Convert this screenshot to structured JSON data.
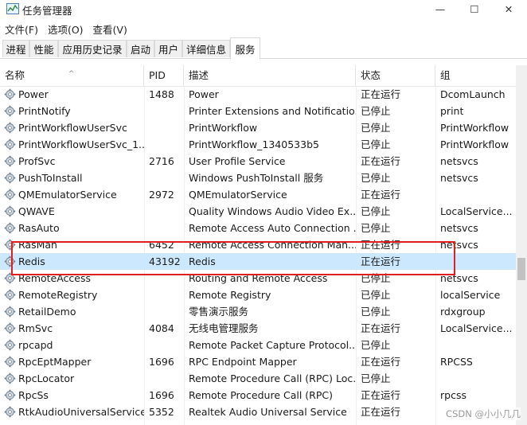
{
  "window": {
    "title": "任务管理器",
    "minimize_glyph": "—",
    "maximize_glyph": "☐",
    "close_glyph": "✕"
  },
  "menu": [
    "文件(F)",
    "选项(O)",
    "查看(V)"
  ],
  "tabs": [
    "进程",
    "性能",
    "应用历史记录",
    "启动",
    "用户",
    "详细信息",
    "服务"
  ],
  "active_tab": "服务",
  "columns": {
    "name": "名称",
    "pid": "PID",
    "desc": "描述",
    "status": "状态",
    "group": "组"
  },
  "sort_indicator": "^",
  "services": [
    {
      "name": "Power",
      "pid": "1488",
      "desc": "Power",
      "status": "正在运行",
      "group": "DcomLaunch"
    },
    {
      "name": "PrintNotify",
      "pid": "",
      "desc": "Printer Extensions and Notificatio...",
      "status": "已停止",
      "group": "print"
    },
    {
      "name": "PrintWorkflowUserSvc",
      "pid": "",
      "desc": "PrintWorkflow",
      "status": "已停止",
      "group": "PrintWorkflow"
    },
    {
      "name": "PrintWorkflowUserSvc_1...",
      "pid": "",
      "desc": "PrintWorkflow_1340533b5",
      "status": "已停止",
      "group": "PrintWorkflow"
    },
    {
      "name": "ProfSvc",
      "pid": "2716",
      "desc": "User Profile Service",
      "status": "正在运行",
      "group": "netsvcs"
    },
    {
      "name": "PushToInstall",
      "pid": "",
      "desc": "Windows PushToInstall 服务",
      "status": "已停止",
      "group": "netsvcs"
    },
    {
      "name": "QMEmulatorService",
      "pid": "2972",
      "desc": "QMEmulatorService",
      "status": "正在运行",
      "group": ""
    },
    {
      "name": "QWAVE",
      "pid": "",
      "desc": "Quality Windows Audio Video Ex...",
      "status": "已停止",
      "group": "LocalService..."
    },
    {
      "name": "RasAuto",
      "pid": "",
      "desc": "Remote Access Auto Connection ...",
      "status": "已停止",
      "group": "netsvcs"
    },
    {
      "name": "RasMan",
      "pid": "6452",
      "desc": "Remote Access Connection Man...",
      "status": "正在运行",
      "group": "netsvcs"
    },
    {
      "name": "Redis",
      "pid": "43192",
      "desc": "Redis",
      "status": "正在运行",
      "group": "",
      "selected": true
    },
    {
      "name": "RemoteAccess",
      "pid": "",
      "desc": "Routing and Remote Access",
      "status": "已停止",
      "group": "netsvcs"
    },
    {
      "name": "RemoteRegistry",
      "pid": "",
      "desc": "Remote Registry",
      "status": "已停止",
      "group": "localService"
    },
    {
      "name": "RetailDemo",
      "pid": "",
      "desc": "零售演示服务",
      "status": "已停止",
      "group": "rdxgroup"
    },
    {
      "name": "RmSvc",
      "pid": "4084",
      "desc": "无线电管理服务",
      "status": "正在运行",
      "group": "LocalService..."
    },
    {
      "name": "rpcapd",
      "pid": "",
      "desc": "Remote Packet Capture Protocol...",
      "status": "已停止",
      "group": ""
    },
    {
      "name": "RpcEptMapper",
      "pid": "1696",
      "desc": "RPC Endpoint Mapper",
      "status": "正在运行",
      "group": "RPCSS"
    },
    {
      "name": "RpcLocator",
      "pid": "",
      "desc": "Remote Procedure Call (RPC) Loc...",
      "status": "已停止",
      "group": ""
    },
    {
      "name": "RpcSs",
      "pid": "1696",
      "desc": "Remote Procedure Call (RPC)",
      "status": "正在运行",
      "group": "rpcss"
    },
    {
      "name": "RtkAudioUniversalService",
      "pid": "5352",
      "desc": "Realtek Audio Universal Service",
      "status": "正在运行",
      "group": ""
    }
  ],
  "watermark": "CSDN @小小几几",
  "colors": {
    "selected_row": "#cce8ff",
    "highlight_box": "#e02020"
  }
}
